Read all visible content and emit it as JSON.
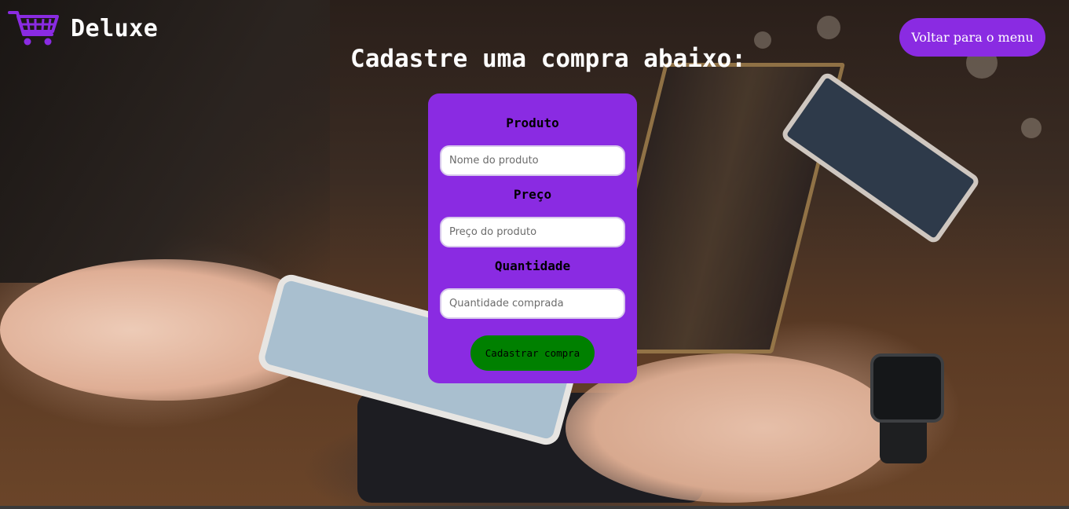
{
  "header": {
    "brand": "Deluxe",
    "logo_icon": "shopping-cart-icon",
    "back_button_label": "Voltar para o menu"
  },
  "page": {
    "title": "Cadastre uma compra abaixo:"
  },
  "form": {
    "fields": [
      {
        "label": "Produto",
        "placeholder": "Nome do produto",
        "value": ""
      },
      {
        "label": "Preço",
        "placeholder": "Preço do produto",
        "value": ""
      },
      {
        "label": "Quantidade",
        "placeholder": "Quantidade comprada",
        "value": ""
      }
    ],
    "submit_label": "Cadastrar compra"
  },
  "colors": {
    "accent": "#8a2be2",
    "submit": "#008000",
    "text_light": "#ffffff"
  }
}
